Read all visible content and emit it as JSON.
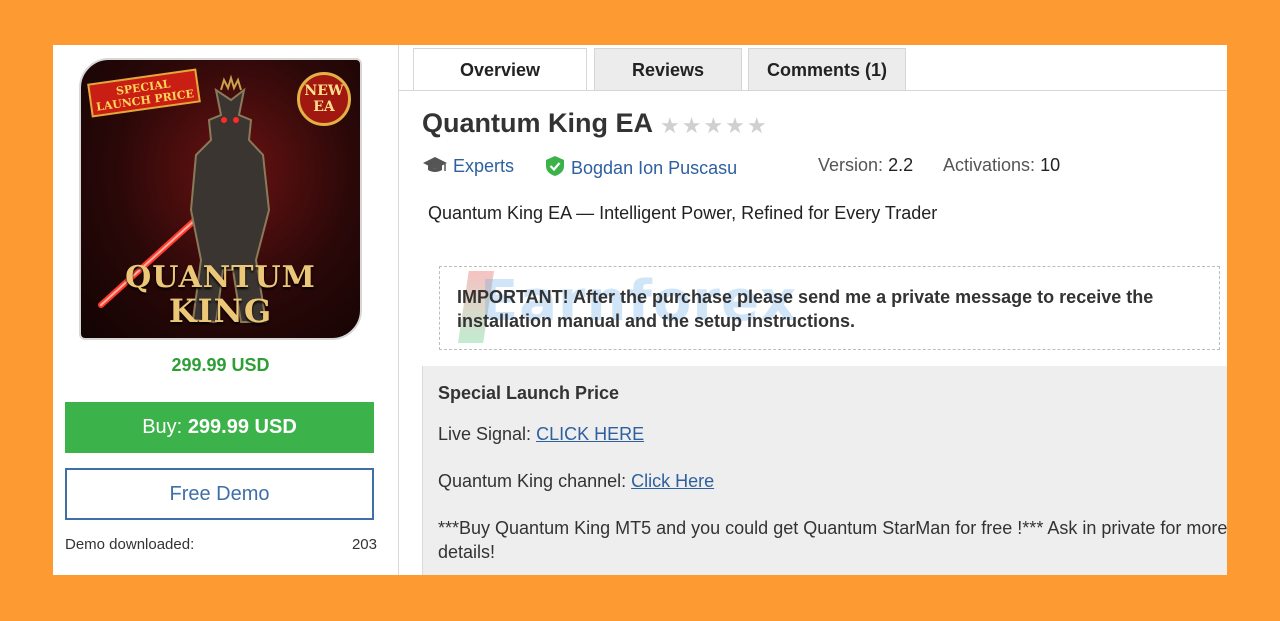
{
  "product": {
    "image_caption_line1": "QUANTUM",
    "image_caption_line2": "KING",
    "ribbon_text": "SPECIAL LAUNCH PRICE",
    "badge_text": "NEW EA",
    "price": "299.99 USD",
    "buy_label": "Buy:",
    "buy_price": "299.99 USD",
    "demo_label": "Free Demo",
    "demo_downloaded_label": "Demo downloaded:",
    "demo_downloaded_count": "203"
  },
  "tabs": [
    {
      "label": "Overview",
      "active": true
    },
    {
      "label": "Reviews",
      "active": false
    },
    {
      "label": "Comments (1)",
      "active": false
    }
  ],
  "header": {
    "title": "Quantum King EA",
    "rating_stars": 0,
    "category": "Experts",
    "author": "Bogdan Ion Puscasu",
    "version_label": "Version:",
    "version_value": "2.2",
    "activations_label": "Activations:",
    "activations_value": "10"
  },
  "tagline": "Quantum King EA — Intelligent Power, Refined for Every Trader",
  "notice": {
    "text": "IMPORTANT! After the purchase please send me a private message to receive the installation manual and the setup instructions.",
    "watermark": "Earnforex"
  },
  "panel": {
    "title": "Special Launch Price",
    "live_signal_label": "Live Signal:",
    "live_signal_link": "CLICK HERE",
    "channel_label": "Quantum King channel:",
    "channel_link": "Click Here",
    "promo": "***Buy Quantum King MT5 and you could get Quantum StarMan for free !*** Ask in private for more details!"
  },
  "colors": {
    "background": "#fd9a32",
    "buy_green": "#3cb34a",
    "price_green": "#2e9e35",
    "link_blue": "#2e5f9e"
  }
}
